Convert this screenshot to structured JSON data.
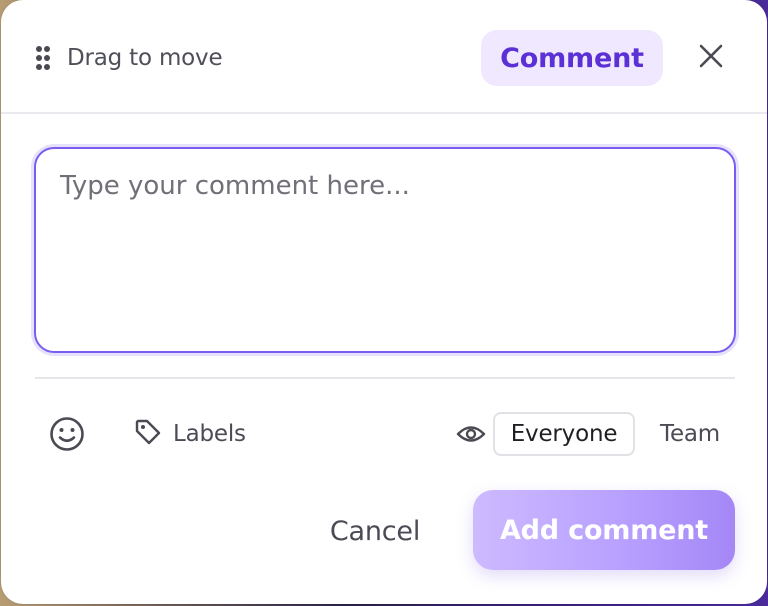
{
  "header": {
    "drag_label": "Drag to move",
    "mode_chip": "Comment"
  },
  "editor": {
    "placeholder": "Type your comment here...",
    "value": ""
  },
  "toolbar": {
    "labels_label": "Labels",
    "visibility_options": [
      "Everyone",
      "Team"
    ],
    "visibility_selected": "Everyone"
  },
  "footer": {
    "cancel_label": "Cancel",
    "submit_label": "Add comment"
  },
  "icons": {
    "drag": "drag-handle-icon",
    "close": "close-icon",
    "emoji": "emoji-icon",
    "tag": "tag-icon",
    "eye": "eye-icon"
  },
  "colors": {
    "accent": "#5b31d6",
    "chip_bg": "#efe8ff",
    "focus_border": "#7b5cf0",
    "submit_gradient_start": "#cdbaff",
    "submit_gradient_end": "#a487f6"
  }
}
